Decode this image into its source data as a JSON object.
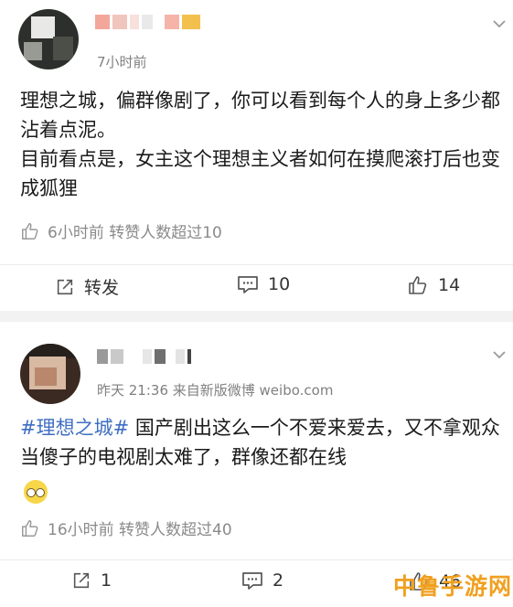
{
  "post1": {
    "time": "7小时前",
    "text": "理想之城，偏群像剧了，你可以看到每个人的身上多少都沾着点泥。\n目前看点是，女主这个理想主义者如何在摸爬滚打后也变成狐狸",
    "sub_text": "6小时前 转赞人数超过10",
    "actions": {
      "repost_label": "转发",
      "comment_count": "10",
      "like_count": "14"
    }
  },
  "post2": {
    "time_source": "昨天 21:36  来自新版微博 weibo.com",
    "hashtag": "#理想之城#",
    "text": " 国产剧出这么一个不爱来爱去，又不拿观众当傻子的电视剧太难了，群像还都在线",
    "sub_text": "16小时前 转赞人数超过40",
    "actions": {
      "repost_count": "1",
      "comment_count": "2",
      "like_count": "46"
    }
  },
  "watermark": "中鲁手游网",
  "colors": {
    "link": "#3f6ec2",
    "meta": "#808080",
    "accent_name": "#f06a5a",
    "watermark": "#f0a020"
  },
  "icons": [
    "chevron-down-icon",
    "thumbs-up-icon",
    "repost-icon",
    "comment-icon",
    "laughing-emoji-icon"
  ]
}
